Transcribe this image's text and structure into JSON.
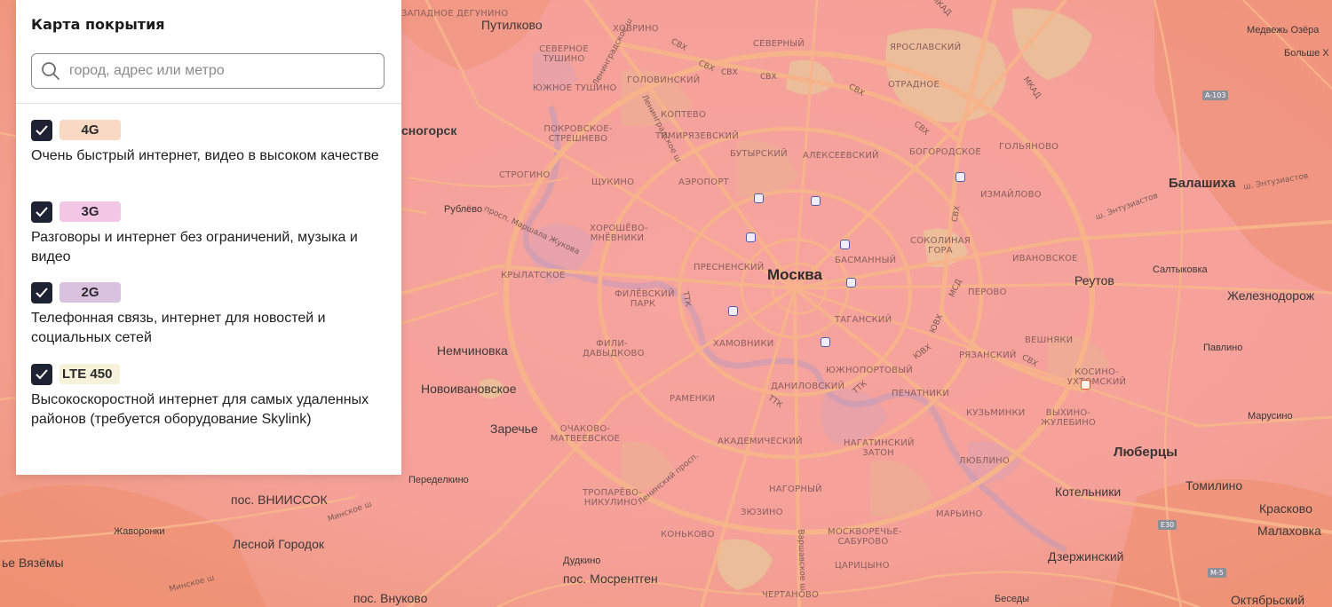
{
  "panel": {
    "title": "Карта покрытия",
    "search_placeholder": "город, адрес или метро",
    "search_value": "",
    "layers": [
      {
        "badge": "4G",
        "badge_color": "#f9d9c4",
        "checked": true,
        "description": "Очень быстрый интернет, видео в высоком качестве"
      },
      {
        "badge": "3G",
        "badge_color": "#f4c6e6",
        "checked": true,
        "description": "Разговоры и интернет без ограничений, музыка и видео"
      },
      {
        "badge": "2G",
        "badge_color": "#d8c2de",
        "checked": true,
        "description": "Телефонная связь, интернет для новостей и социальных сетей"
      },
      {
        "badge": "LTE 450",
        "badge_color": "#f6f1d9",
        "checked": true,
        "description": "Высокоскоростной интернет для самых удаленных районов (требуется оборудование Skylink)"
      }
    ]
  },
  "colors": {
    "coverage_4g": "#f5a198",
    "coverage_edge": "#ee8f6f",
    "park": "#e7c89a",
    "roads": "#f7b78b",
    "check_bg": "#1f2233",
    "metro": "#4b5fa8"
  },
  "map": {
    "labels": {
      "moscow": "Москва",
      "putilkovo": "Путилково",
      "krasnogorsk": "сногорск",
      "rublevo": "Рублёво",
      "nemchinovka": "Немчиновка",
      "novoivanovskoe": "Новоивановское",
      "zarechye": "Заречье",
      "vniissok": "пос. ВНИИССОК",
      "lesnoy": "Лесной Городок",
      "zhavoronki": "Жаворонки",
      "vyazemy": "ье Вязёмы",
      "vnukovo": "пос. Внуково",
      "mosrentgen": "пос. Мосрентген",
      "dudkino": "Дудкино",
      "peredelkino": "Переделкино",
      "reutov": "Реутов",
      "balashikha": "Балашиха",
      "lyubertsy": "Люберцы",
      "kotelniki": "Котельники",
      "dzerzhinsky": "Дзержинский",
      "tomilino": "Томилино",
      "kraskovo": "Красково",
      "malakhovka": "Малаховка",
      "oktyabrsky": "Октябрьский",
      "zheleznodorozhny": "Железнодорож",
      "saltykovka": "Салтыковка",
      "pavlino": "Павлино",
      "marusino": "Марусино",
      "medvezhi": "Медвежь Озёра",
      "bolshie": "Больше Х",
      "besedy": "Беседы",
      "lenin_sh": "Ленинградское ш",
      "lenin_sh2": "Ленинградское ш",
      "khovrino": "ХОВРИНО",
      "zapadnoe_degunino": "ЗАПАДНОЕ ДЕГУНИНО",
      "severnoe_tushino": "СЕВЕРНОЕ ТУШИНО",
      "yuzhnoe_tushino": "ЮЖНОЕ ТУШИНО",
      "golovinsky": "ГОЛОВИНСКИЙ",
      "koptevo": "КОПТЕВО",
      "pokrovskoe": "ПОКРОВСКОЕ-СТРЕШНЕВО",
      "strogino": "СТРОГИНО",
      "shchukino": "ЩУКИНО",
      "khoroshevo": "ХОРОШЁВО-МНЁВНИКИ",
      "krylatskoe": "КРЫЛАТСКОЕ",
      "filevsky": "ФИЛЁВСКИЙ ПАРК",
      "fili": "ФИЛИ-ДАВЫДКОВО",
      "ramenki": "РАМЕНКИ",
      "ochakovo": "ОЧАКОВО-МАТВЕЕВСКОЕ",
      "akademicheskiy": "АКАДЕМИЧЕСКИЙ",
      "troparevo": "ТРОПАРЁВО-НИКУЛИНО",
      "konkovo": "КОНЬКОВО",
      "zyuzino": "ЗЮЗИНО",
      "nagorny": "НАГОРНЫЙ",
      "danilovsky": "ДАНИЛОВСКИЙ",
      "khamovniki": "ХАМОВНИКИ",
      "presnensky": "ПРЕСНЕНСКИЙ",
      "aeroport": "АЭРОПОРТ",
      "timiryazevsky": "ТИМИРЯЗЕВСКИЙ",
      "butyrsky": "БУТЫРСКИЙ",
      "alekseevsky": "АЛЕКСЕЕВСКИЙ",
      "bogorodskoe": "БОГОРОДСКОЕ",
      "golyanovo": "ГОЛЬЯНОВО",
      "izmailovo": "ИЗМАЙЛОВО",
      "sokolinaya": "СОКОЛИНАЯ ГОРА",
      "basmanny": "БАСМАННЫЙ",
      "taganskiy": "ТАГАНСКИЙ",
      "perovo": "ПЕРОВО",
      "ivanovskoe": "ИВАНОВСКОЕ",
      "veshnyaki": "ВЕШНЯКИ",
      "ryazansky": "РЯЗАНСКИЙ",
      "kuzminki": "КУЗЬМИНКИ",
      "vykhino": "ВЫХИНО-ЖУЛЕБИНО",
      "kosino": "КОСИНО-УХТОМСКИЙ",
      "yuzhnoportovy": "ЮЖНОПОРТОВЫЙ",
      "pechatniki": "ПЕЧАТНИКИ",
      "nagatinsky": "НАГАТИНСКИЙ ЗАТОН",
      "lyublino": "ЛЮБЛИНО",
      "maryino": "МАРЬИНО",
      "moskvorechye": "МОСКВОРЕЧЬЕ-САБУРОВО",
      "tsaritsyno": "ЦАРИЦЫНО",
      "chertanovo": "ЧЕРТАНОВО",
      "yaroslavsky": "ЯРОСЛАВСКИЙ",
      "otradnoe": "ОТРАДНОЕ",
      "northern": "СЕВЕРНЫЙ",
      "lyublino2": "ЛЮБЛИНО",
      "svh1": "СВХ",
      "svh2": "СВХ",
      "svh3": "СВХ",
      "svh4": "СВХ",
      "svh5": "СВХ",
      "svh6": "СВХ",
      "svh7": "СВХ",
      "svh8": "СВХ",
      "ttk1": "ТТК",
      "ttk2": "ТТК",
      "ttk3": "ТТК",
      "mkad1": "МКАД",
      "mkad2": "МКАД",
      "mcd": "МСД",
      "yuvkh1": "ЮВХ",
      "yuvkh2": "ЮВХ",
      "zhukov": "просп. Маршала Жукова",
      "leninsky": "Ленинский просп.",
      "varshavskoe": "Варшавское ш",
      "minskoe1": "Минское ш",
      "minskoe2": "Минское ш",
      "entuziastov1": "ш. Энтузиастов",
      "entuziastov2": "ш. Энтузиастов",
      "a103": "A-103",
      "e30": "E30",
      "m5": "M-5"
    }
  }
}
